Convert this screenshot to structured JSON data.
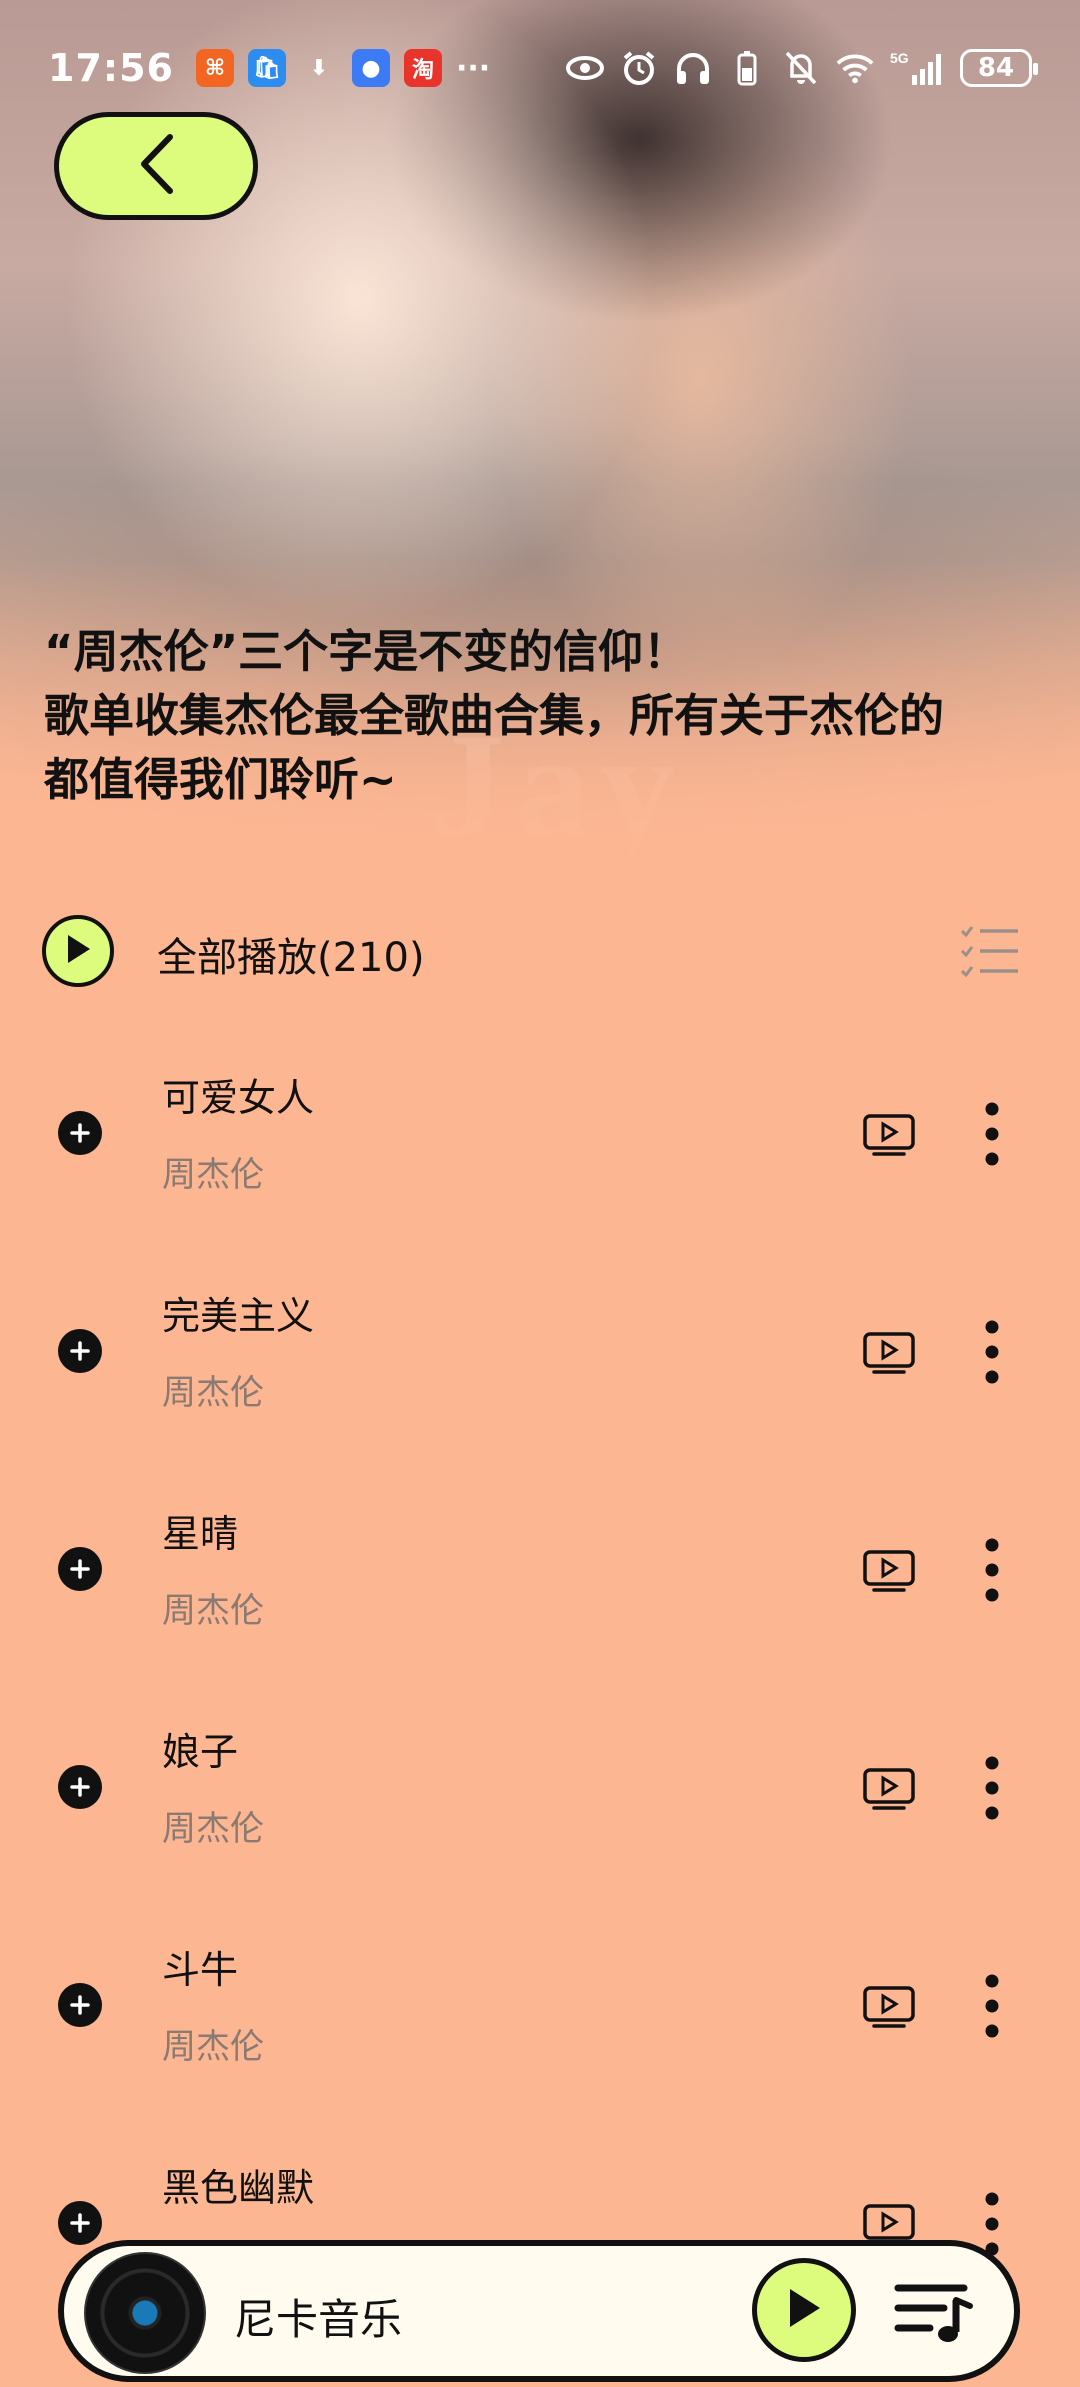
{
  "status_bar": {
    "time": "17:56",
    "app_icons": [
      {
        "name": "app1-icon",
        "glyph": "⌘",
        "color": "#F26522"
      },
      {
        "name": "app-store-icon",
        "glyph": "🛍",
        "color": "#2D8CF0"
      },
      {
        "name": "download-icon",
        "glyph": "⬇",
        "color": "transparent"
      },
      {
        "name": "app4-icon",
        "glyph": "●",
        "color": "#3C7BF5"
      },
      {
        "name": "taobao-icon",
        "glyph": "淘",
        "color": "#E8342A"
      }
    ],
    "more": "···",
    "battery": "84"
  },
  "playlist": {
    "description_line1": "“周杰伦”三个字是不变的信仰！",
    "description_line2": "歌单收集杰伦最全歌曲合集，所有关于杰伦的",
    "description_line3": "都值得我们聆听~",
    "play_all_label": "全部播放(210)"
  },
  "songs": [
    {
      "title": "可爱女人",
      "artist": "周杰伦"
    },
    {
      "title": "完美主义",
      "artist": "周杰伦"
    },
    {
      "title": "星晴",
      "artist": "周杰伦"
    },
    {
      "title": "娘子",
      "artist": "周杰伦"
    },
    {
      "title": "斗牛",
      "artist": "周杰伦"
    },
    {
      "title": "黑色幽默",
      "artist": ""
    }
  ],
  "player": {
    "title": "尼卡音乐"
  },
  "colors": {
    "background": "#FDB692",
    "accent": "#DDFB7C",
    "player_bg": "#FFFCEF"
  }
}
